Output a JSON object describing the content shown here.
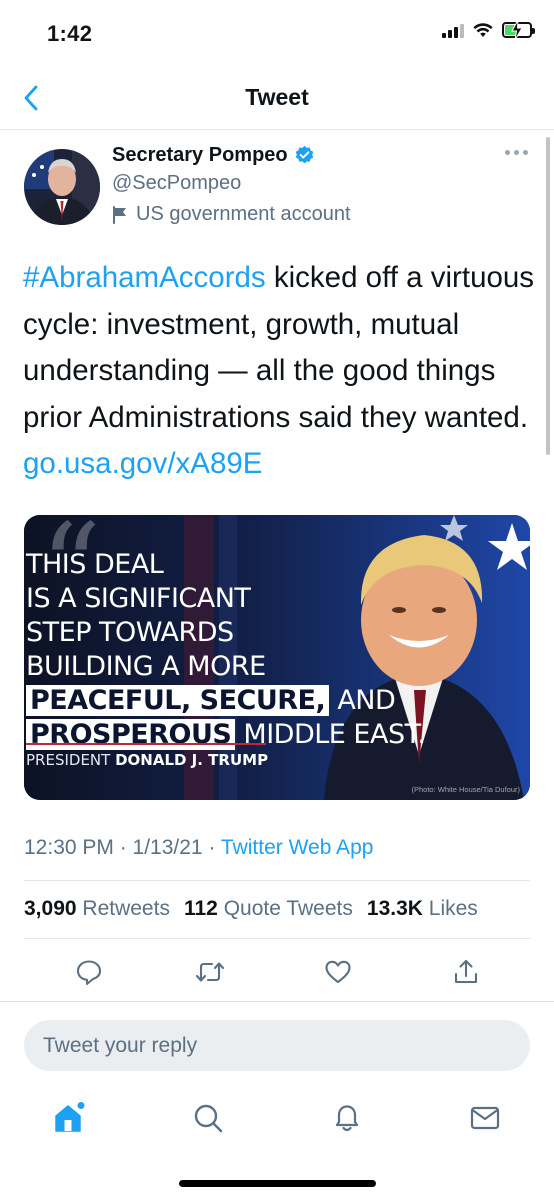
{
  "status_bar": {
    "time": "1:42",
    "battery_level": 0.45,
    "charging": true,
    "battery_color": "#4cd964"
  },
  "header": {
    "title": "Tweet",
    "back_icon": "chevron-left-icon"
  },
  "tweet": {
    "author": {
      "name": "Secretary Pompeo",
      "handle": "@SecPompeo",
      "verified": true,
      "label": "US government account",
      "label_icon": "flag-icon"
    },
    "text": {
      "hashtag": "#AbrahamAccords",
      "body": " kicked off a virtuous cycle: investment, growth, mutual understanding — all the good things prior Administrations said they wanted. ",
      "link": "go.usa.gov/xA89E"
    },
    "media": {
      "quote_line_1": "THIS DEAL",
      "quote_line_2": "IS A SIGNIFICANT",
      "quote_line_3": "STEP TOWARDS",
      "quote_line_4": "BUILDING A MORE",
      "quote_highlight_1": "PEACEFUL, SECURE,",
      "quote_after_1": " AND",
      "quote_highlight_2": "PROSPEROUS",
      "quote_after_2": " MIDDLE EAST.",
      "attribution_prefix": "PRESIDENT ",
      "attribution_name": "DONALD J. TRUMP",
      "photo_credit": "(Photo: White House/Tia Dufour)"
    },
    "timestamp": "12:30 PM · 1/13/21 · ",
    "source": "Twitter Web App",
    "stats": {
      "retweets_count": "3,090",
      "retweets_label": "Retweets",
      "quotes_count": "112",
      "quotes_label": "Quote Tweets",
      "likes_count": "13.3K",
      "likes_label": "Likes"
    },
    "actions": [
      "reply-icon",
      "retweet-icon",
      "like-icon",
      "share-icon"
    ]
  },
  "reply": {
    "placeholder": "Tweet your reply"
  },
  "tab_bar": {
    "tabs": [
      "home-icon",
      "search-icon",
      "notifications-icon",
      "messages-icon"
    ],
    "accent": "#1da1f2"
  }
}
